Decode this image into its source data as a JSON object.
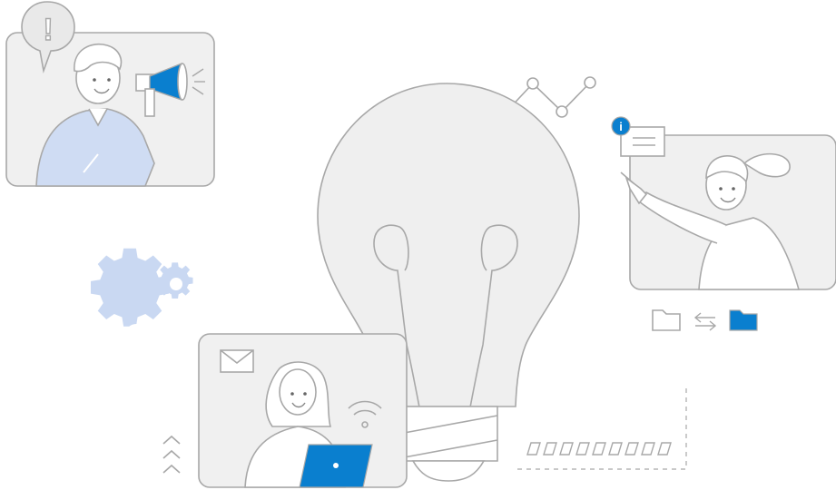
{
  "illustration": {
    "alert_symbol": "!",
    "notice_symbol": "i"
  },
  "colors": {
    "accent": "#0a7fcf",
    "light_blue": "#cfdcf3",
    "gear_blue": "#c9d8f2",
    "outline": "#a8a8a8",
    "fill_gray": "#f0f0f0",
    "bulb_gray": "#efefef"
  },
  "icons": [
    "alert-bubble-icon",
    "megaphone-icon",
    "gear-icon",
    "mail-icon",
    "wifi-icon",
    "laptop-icon",
    "info-badge-icon",
    "folder-icon",
    "transfer-arrows-icon",
    "chevron-up-icon",
    "trend-line-icon",
    "lightbulb-icon"
  ]
}
